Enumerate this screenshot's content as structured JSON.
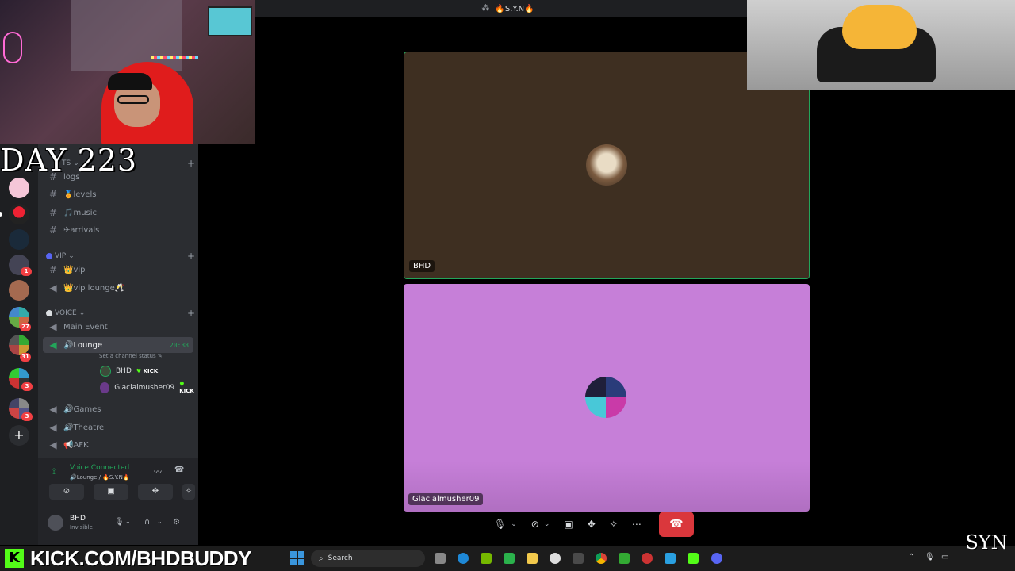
{
  "titlebar": {
    "server_name": "🔥S.Y.N🔥",
    "server_icon": "server-icon"
  },
  "webcam": {
    "label": "streamer-webcam"
  },
  "overlay": {
    "day_label": "DAY 223"
  },
  "sidebar": {
    "partial_category": "TS",
    "channels_top": [
      {
        "icon": "#",
        "label": "logs"
      },
      {
        "icon": "#",
        "label": "🏅levels"
      },
      {
        "icon": "#",
        "label": "🎵music"
      },
      {
        "icon": "#",
        "label": "✈arrivals"
      }
    ],
    "vip_category": "VIP",
    "vip_channels": [
      {
        "icon": "#",
        "label": "👑vip"
      },
      {
        "icon": "🔊",
        "label": "👑vip lounge🥂"
      }
    ],
    "voice_category": "VOICE",
    "voice_channels": [
      {
        "label": "Main Event"
      },
      {
        "label": "🔊Lounge",
        "timer": "20:38",
        "status_placeholder": "Set a channel status"
      },
      {
        "label": "🔊Games"
      },
      {
        "label": "🔊Theatre"
      },
      {
        "label": "📢AFK"
      }
    ],
    "lounge_members": [
      {
        "name": "BHD",
        "badge": "KICK"
      },
      {
        "name": "Glacialmusher09",
        "badge": "KICK"
      }
    ]
  },
  "rail": {
    "badges": [
      "1",
      "27",
      "31",
      "3",
      "3"
    ],
    "add_server": "+"
  },
  "voice_panel": {
    "title": "Voice Connected",
    "subtitle": "🔊Lounge / 🔥S.Y.N🔥",
    "username": "BHD",
    "user_status": "Invisible"
  },
  "tiles": [
    {
      "name": "BHD",
      "bg": "#3e2f21"
    },
    {
      "name": "Glacialmusher09",
      "bg": "#c67fd8"
    }
  ],
  "taskbar": {
    "kick_text": "KICK.COM/BHDBUDDY",
    "search_placeholder": "Search"
  },
  "watermark": {
    "text": "SYN"
  },
  "colors": {
    "accent_green": "#23a55a",
    "danger": "#da373c",
    "kick_green": "#53fc18"
  }
}
